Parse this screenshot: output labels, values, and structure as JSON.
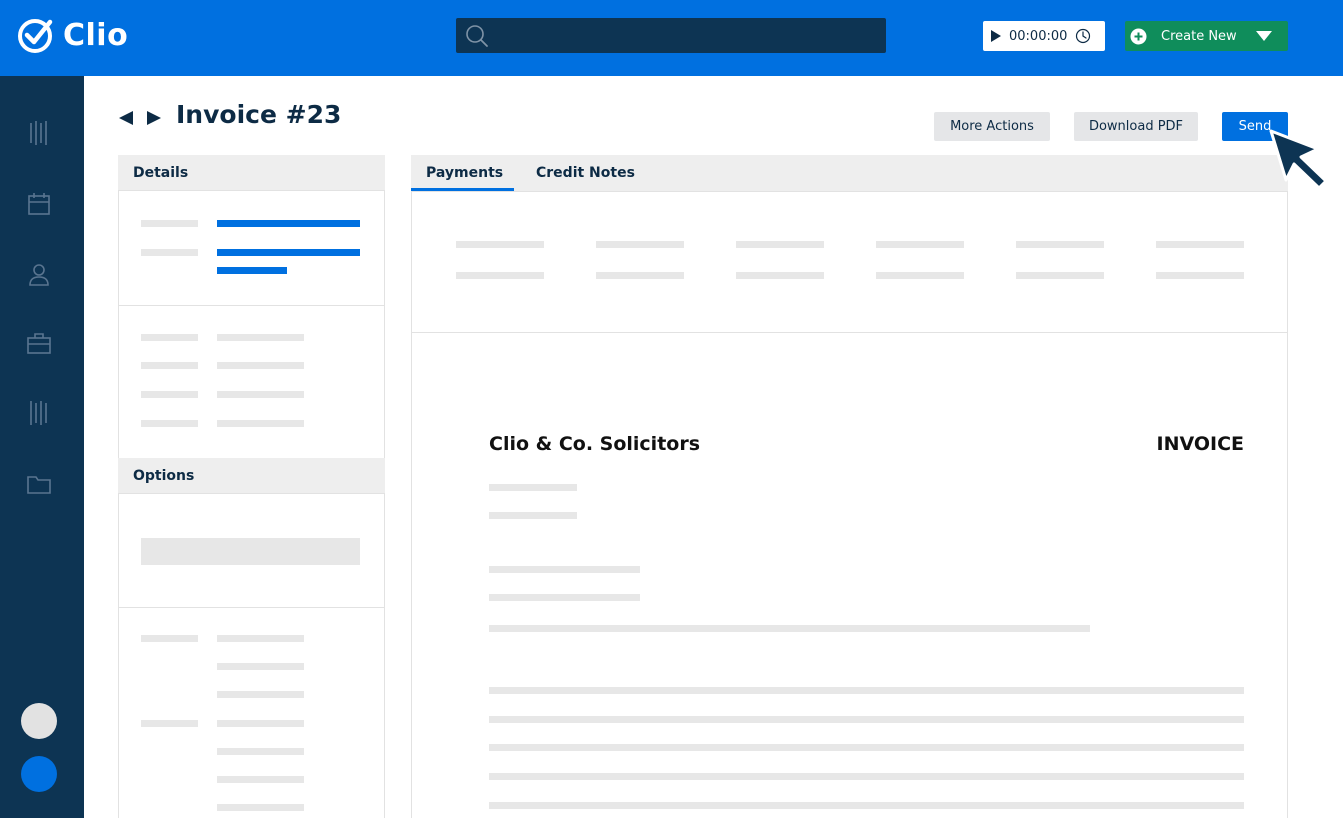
{
  "app": {
    "name": "Clio"
  },
  "header": {
    "timer": "00:00:00",
    "create_label": "Create New"
  },
  "page": {
    "title": "Invoice #23",
    "actions": {
      "more": "More Actions",
      "pdf": "Download PDF",
      "send": "Send"
    }
  },
  "left_panel": {
    "details_title": "Details",
    "options_title": "Options"
  },
  "tabs": {
    "payments": "Payments",
    "credit_notes": "Credit Notes"
  },
  "invoice": {
    "company": "Clio & Co. Solicitors",
    "doc_label": "INVOICE"
  },
  "colors": {
    "brand_blue": "#0070e0",
    "navy": "#0d3453",
    "create_green": "#0f8d5b"
  },
  "icons": [
    "check-circle-icon",
    "search-icon",
    "play-icon",
    "clock-icon",
    "plus-circle-icon",
    "caret-down-icon",
    "activity-icon",
    "calendar-icon",
    "person-icon",
    "briefcase-icon",
    "billing-icon",
    "folder-icon",
    "prev-arrow-icon",
    "next-arrow-icon",
    "cursor-icon"
  ]
}
